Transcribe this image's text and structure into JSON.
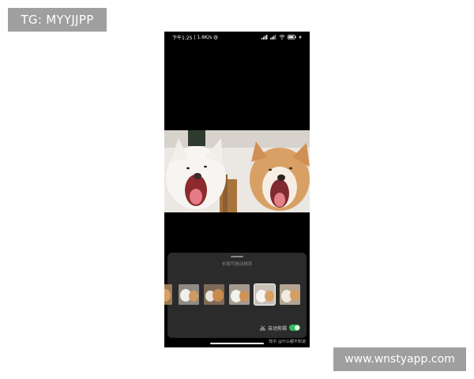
{
  "overlay": {
    "top_left_badge": "TG: MYYJJPP",
    "bottom_right_badge": "www.wnstyapp.com"
  },
  "status_bar": {
    "time": "下午1:25",
    "network_speed": "1.6K/s",
    "icons": [
      "alarm-icon",
      "signal-icon",
      "signal-icon",
      "wifi-icon",
      "battery-icon",
      "charging-icon"
    ]
  },
  "editor": {
    "reorder_hint": "长按可拖动排序",
    "auto_cut_label": "自动剪辑",
    "auto_cut_enabled": true,
    "selected_thumbnail_index": 4,
    "thumbnail_count": 6
  },
  "source_watermark": "知乎 @什么都不知道",
  "colors": {
    "screen_bg": "#000000",
    "panel_bg": "#2b2b2b",
    "toggle_on": "#2fbf5a",
    "badge_bg": "#9f9f9f"
  }
}
